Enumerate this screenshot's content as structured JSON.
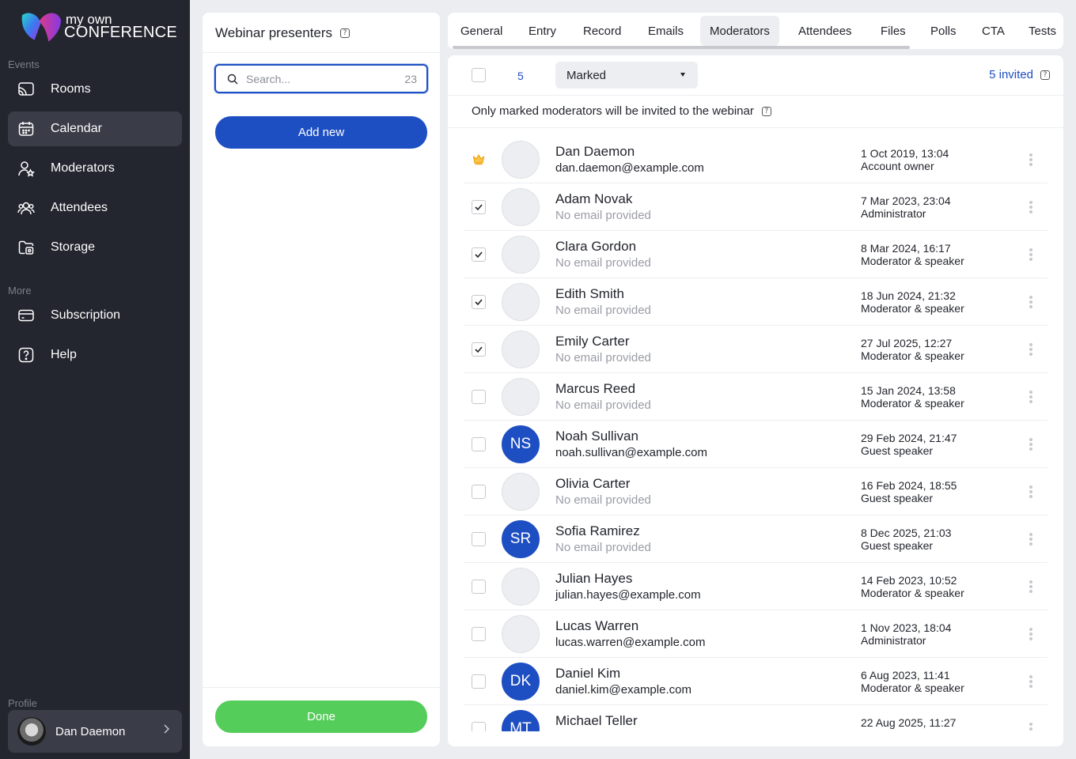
{
  "app": {
    "logo_line1": "my own",
    "logo_line2": "CONFERENCE"
  },
  "sidebar": {
    "section_events": "Events",
    "section_more": "More",
    "section_profile": "Profile",
    "items": [
      {
        "label": "Rooms",
        "icon": "cast-icon"
      },
      {
        "label": "Calendar",
        "icon": "calendar-icon",
        "active": true
      },
      {
        "label": "Moderators",
        "icon": "user-star-icon"
      },
      {
        "label": "Attendees",
        "icon": "users-icon"
      },
      {
        "label": "Storage",
        "icon": "folder-icon"
      },
      {
        "label": "Subscription",
        "icon": "card-icon"
      },
      {
        "label": "Help",
        "icon": "help-icon"
      }
    ],
    "profile_name": "Dan Daemon"
  },
  "presenters": {
    "title": "Webinar presenters",
    "search_placeholder": "Search...",
    "search_count": "23",
    "add_new": "Add new",
    "done": "Done"
  },
  "tabs": [
    "General",
    "Entry",
    "Record",
    "Emails",
    "Moderators",
    "Attendees",
    "Files",
    "Polls",
    "CTA",
    "Tests"
  ],
  "active_tab": "Moderators",
  "toolbar": {
    "selected_count": "5",
    "filter_value": "Marked",
    "invited": "5 invited",
    "note": "Only marked moderators will be invited to the webinar"
  },
  "moderators": [
    {
      "name": "Dan Daemon",
      "email": "dan.daemon@example.com",
      "date": "1 Oct 2019, 13:04",
      "role": "Account owner",
      "owner": true,
      "checked": false,
      "initials": ""
    },
    {
      "name": "Adam Novak",
      "email": "No email provided",
      "date": "7 Mar 2023, 23:04",
      "role": "Administrator",
      "owner": false,
      "checked": true,
      "initials": ""
    },
    {
      "name": "Clara Gordon",
      "email": "No email provided",
      "date": "8 Mar 2024, 16:17",
      "role": "Moderator & speaker",
      "owner": false,
      "checked": true,
      "initials": ""
    },
    {
      "name": "Edith Smith",
      "email": "No email provided",
      "date": "18 Jun 2024, 21:32",
      "role": "Moderator & speaker",
      "owner": false,
      "checked": true,
      "initials": ""
    },
    {
      "name": "Emily Carter",
      "email": "No email provided",
      "date": "27 Jul 2025, 12:27",
      "role": "Moderator & speaker",
      "owner": false,
      "checked": true,
      "initials": ""
    },
    {
      "name": "Marcus Reed",
      "email": "No email provided",
      "date": "15 Jan 2024, 13:58",
      "role": "Moderator & speaker",
      "owner": false,
      "checked": false,
      "initials": ""
    },
    {
      "name": "Noah Sullivan",
      "email": "noah.sullivan@example.com",
      "date": "29 Feb 2024, 21:47",
      "role": "Guest speaker",
      "owner": false,
      "checked": false,
      "initials": "NS"
    },
    {
      "name": "Olivia Carter",
      "email": "No email provided",
      "date": "16 Feb 2024, 18:55",
      "role": "Guest speaker",
      "owner": false,
      "checked": false,
      "initials": ""
    },
    {
      "name": "Sofia Ramirez",
      "email": "No email provided",
      "date": "8 Dec 2025, 21:03",
      "role": "Guest speaker",
      "owner": false,
      "checked": false,
      "initials": "SR"
    },
    {
      "name": "Julian Hayes",
      "email": "julian.hayes@example.com",
      "date": "14 Feb 2023, 10:52",
      "role": "Moderator & speaker",
      "owner": false,
      "checked": false,
      "initials": ""
    },
    {
      "name": "Lucas Warren",
      "email": "lucas.warren@example.com",
      "date": "1 Nov 2023, 18:04",
      "role": "Administrator",
      "owner": false,
      "checked": false,
      "initials": ""
    },
    {
      "name": "Daniel Kim",
      "email": "daniel.kim@example.com",
      "date": "6 Aug 2023, 11:41",
      "role": "Moderator & speaker",
      "owner": false,
      "checked": false,
      "initials": "DK"
    },
    {
      "name": "Michael Teller",
      "email": "",
      "date": "22 Aug 2025, 11:27",
      "role": "",
      "owner": false,
      "checked": false,
      "initials": "MT"
    }
  ],
  "colors": {
    "accent": "#1e4fc2",
    "success": "#55cd5a",
    "sidebar_bg": "#23252f",
    "crown": "#f2a413"
  }
}
